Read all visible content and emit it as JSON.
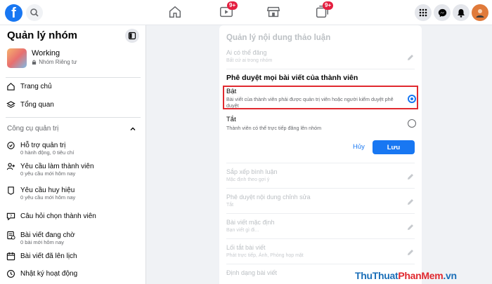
{
  "topbar": {
    "logo": "f",
    "notifications": {
      "video_badge": "9+",
      "groups_badge": "9+"
    }
  },
  "sidebar": {
    "title": "Quản lý nhóm",
    "group_name": "Working",
    "group_privacy": "Nhóm Riêng tư",
    "nav": [
      {
        "label": "Trang chủ"
      },
      {
        "label": "Tổng quan"
      }
    ],
    "tools_section": "Công cụ quản trị",
    "tools": [
      {
        "label": "Hỗ trợ quản trị",
        "sub": "0 hành động, 0 tiêu chí"
      },
      {
        "label": "Yêu cầu làm thành viên",
        "sub": "0 yêu cầu mới hôm nay"
      },
      {
        "label": "Yêu cầu huy hiệu",
        "sub": "0 yêu cầu mới hôm nay"
      },
      {
        "label": "Câu hỏi chọn thành viên",
        "sub": ""
      },
      {
        "label": "Bài viết đang chờ",
        "sub": "0 bài mới hôm nay"
      },
      {
        "label": "Bài viết đã lên lịch",
        "sub": ""
      },
      {
        "label": "Nhật ký hoạt động",
        "sub": ""
      }
    ]
  },
  "main": {
    "title": "Quản lý nội dung thảo luận",
    "who_can_post": {
      "title": "Ai có thể đăng",
      "sub": "Bất cứ ai trong nhóm"
    },
    "approve_title": "Phê duyệt mọi bài viết của thành viên",
    "option_on": {
      "title": "Bật",
      "desc": "Bài viết của thành viên phải được quản trị viên hoặc người kiểm duyệt phê duyệt"
    },
    "option_off": {
      "title": "Tắt",
      "desc": "Thành viên có thể trực tiếp đăng lên nhóm"
    },
    "cancel_label": "Hủy",
    "save_label": "Lưu",
    "rows": [
      {
        "title": "Sắp xếp bình luận",
        "sub": "Mặc định theo gợi ý"
      },
      {
        "title": "Phê duyệt nội dung chỉnh sửa",
        "sub": "Tắt"
      },
      {
        "title": "Bài viết mặc định",
        "sub": "Bạn viết gì đi..."
      },
      {
        "title": "Lối tắt bài viết",
        "sub": "Phát trực tiếp, Ảnh, Phòng họp mặt"
      },
      {
        "title": "Định dạng bài viết",
        "sub": ""
      }
    ]
  },
  "watermark": {
    "part1": "ThuThuat",
    "part2": "PhanMem",
    "part3": ".vn"
  },
  "colors": {
    "accent": "#1877f2",
    "highlight": "#e0292f",
    "badge": "#e41e3f"
  }
}
